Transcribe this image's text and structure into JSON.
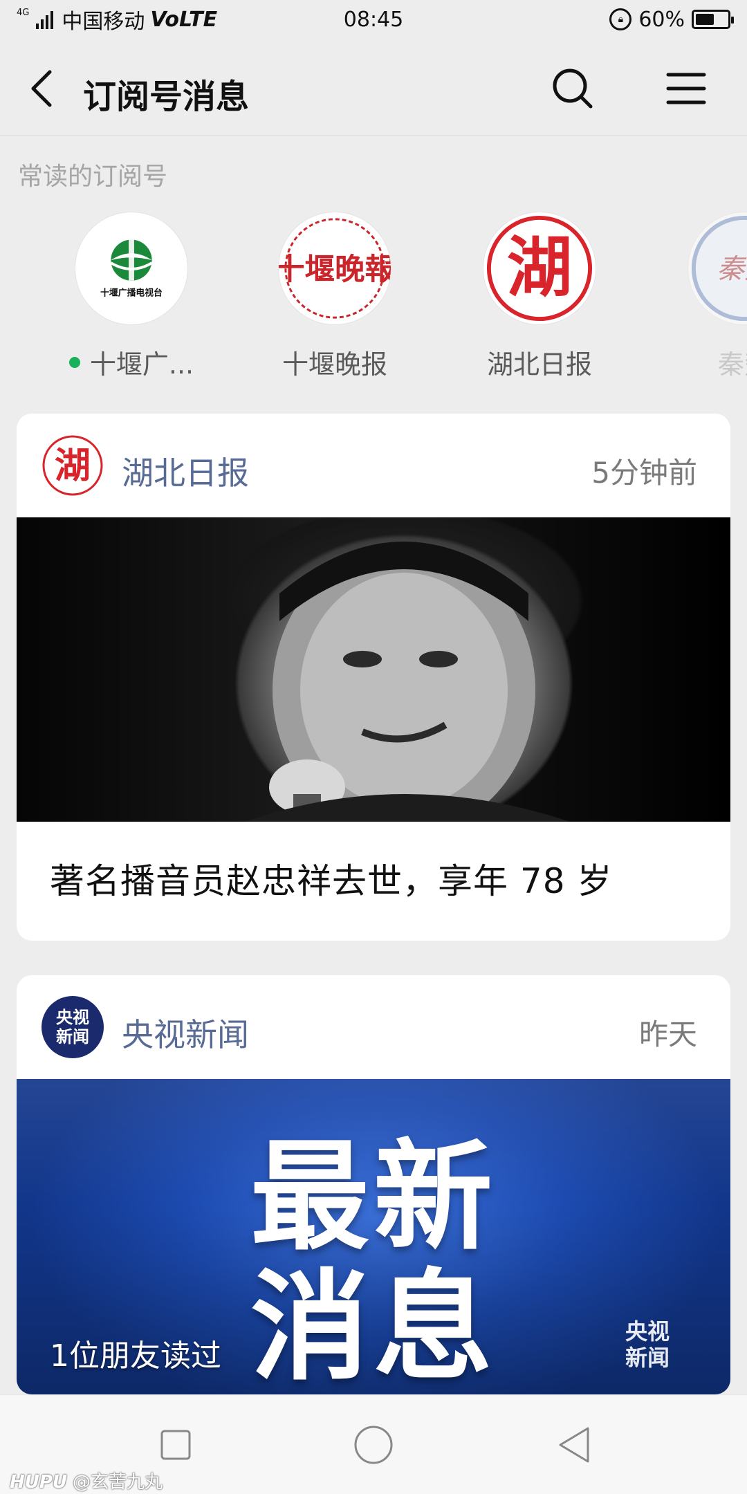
{
  "status_bar": {
    "network_tag": "4G",
    "carrier": "中国移动",
    "volte": "VoLTE",
    "time": "08:45",
    "battery": "60%",
    "battery_level": 0.6
  },
  "nav": {
    "title": "订阅号消息"
  },
  "frequent": {
    "label": "常读的订阅号",
    "items": [
      {
        "name": "十堰广...",
        "logo_text": "十堰广播电视台",
        "unread": true
      },
      {
        "name": "十堰晚报",
        "logo_text": "十堰晚報"
      },
      {
        "name": "湖北日报",
        "logo_text": "湖"
      },
      {
        "name": "秦楚",
        "logo_text": "秦楚"
      }
    ]
  },
  "cards": [
    {
      "source": "湖北日报",
      "logo_text": "湖",
      "time": "5分钟前",
      "headline": "著名播音员赵忠祥去世，享年 78 岁"
    },
    {
      "source": "央视新闻",
      "logo_text": "央视新闻",
      "logo_line1": "央视",
      "logo_line2": "新闻",
      "time": "昨天",
      "image_line1": "最新",
      "image_line2": "消息",
      "read_by": "1位朋友读过",
      "image_mark_line1": "央视",
      "image_mark_line2": "新闻"
    }
  ],
  "watermark": {
    "brand": "HUPU",
    "handle": "@玄苦九丸"
  },
  "colors": {
    "background": "#ededed",
    "link_blue": "#576b95",
    "unread_green": "#19b25a",
    "hubei_red": "#d8242a",
    "cctv_navy": "#1a2a6c"
  }
}
